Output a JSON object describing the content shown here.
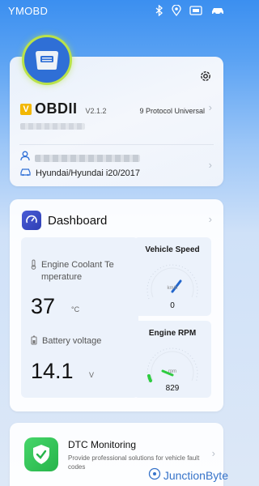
{
  "status_bar": {
    "app_name": "YMOBD",
    "icons": [
      "bluetooth-icon",
      "location-pin-icon",
      "obd-connector-icon",
      "car-icon"
    ]
  },
  "device_card": {
    "badge_letter": "V",
    "device_name": "OBDII",
    "version": "V2.1.2",
    "protocol": "9 Protocol Universal",
    "vehicle": "Hyundai/Hyundai i20/2017"
  },
  "dashboard": {
    "title": "Dashboard",
    "coolant_label": "Engine Coolant Te mperature",
    "coolant_value": "37",
    "coolant_unit": "°C",
    "battery_label": "Battery voltage",
    "battery_value": "14.1",
    "battery_unit": "V",
    "speed_title": "Vehicle Speed",
    "speed_unit": "km/h",
    "speed_value": "0",
    "rpm_title": "Engine RPM",
    "rpm_unit": "rpm",
    "rpm_value": "829"
  },
  "dtc": {
    "title": "DTC Monitoring",
    "description": "Provide professional solutions for vehicle fault codes"
  },
  "watermark": {
    "text": "JunctionByte"
  },
  "colors": {
    "accent_blue": "#2f6fd6",
    "badge_yellow": "#f2b705",
    "rpm_green": "#2ecc40",
    "speed_needle": "#2266cc",
    "dtc_green": "#27b44a"
  }
}
